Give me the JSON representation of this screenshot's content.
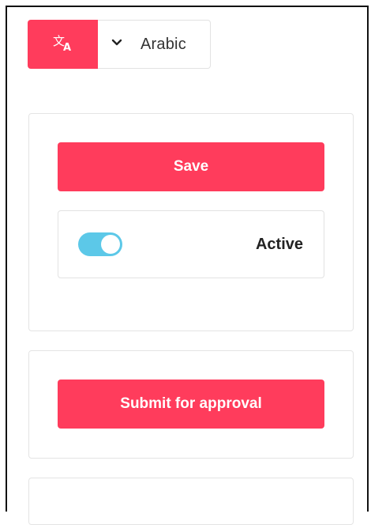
{
  "language_bar": {
    "translate_icon": "translate-icon",
    "dropdown_icon": "chevron-down-icon",
    "selected_language": "Arabic"
  },
  "publish_card": {
    "save_label": "Save",
    "status": {
      "label": "Active",
      "enabled": true
    }
  },
  "approval_card": {
    "submit_label": "Submit for approval"
  },
  "colors": {
    "accent": "#ff3c5c",
    "toggle_on": "#5cc8e8",
    "border": "#e4e4e4"
  }
}
